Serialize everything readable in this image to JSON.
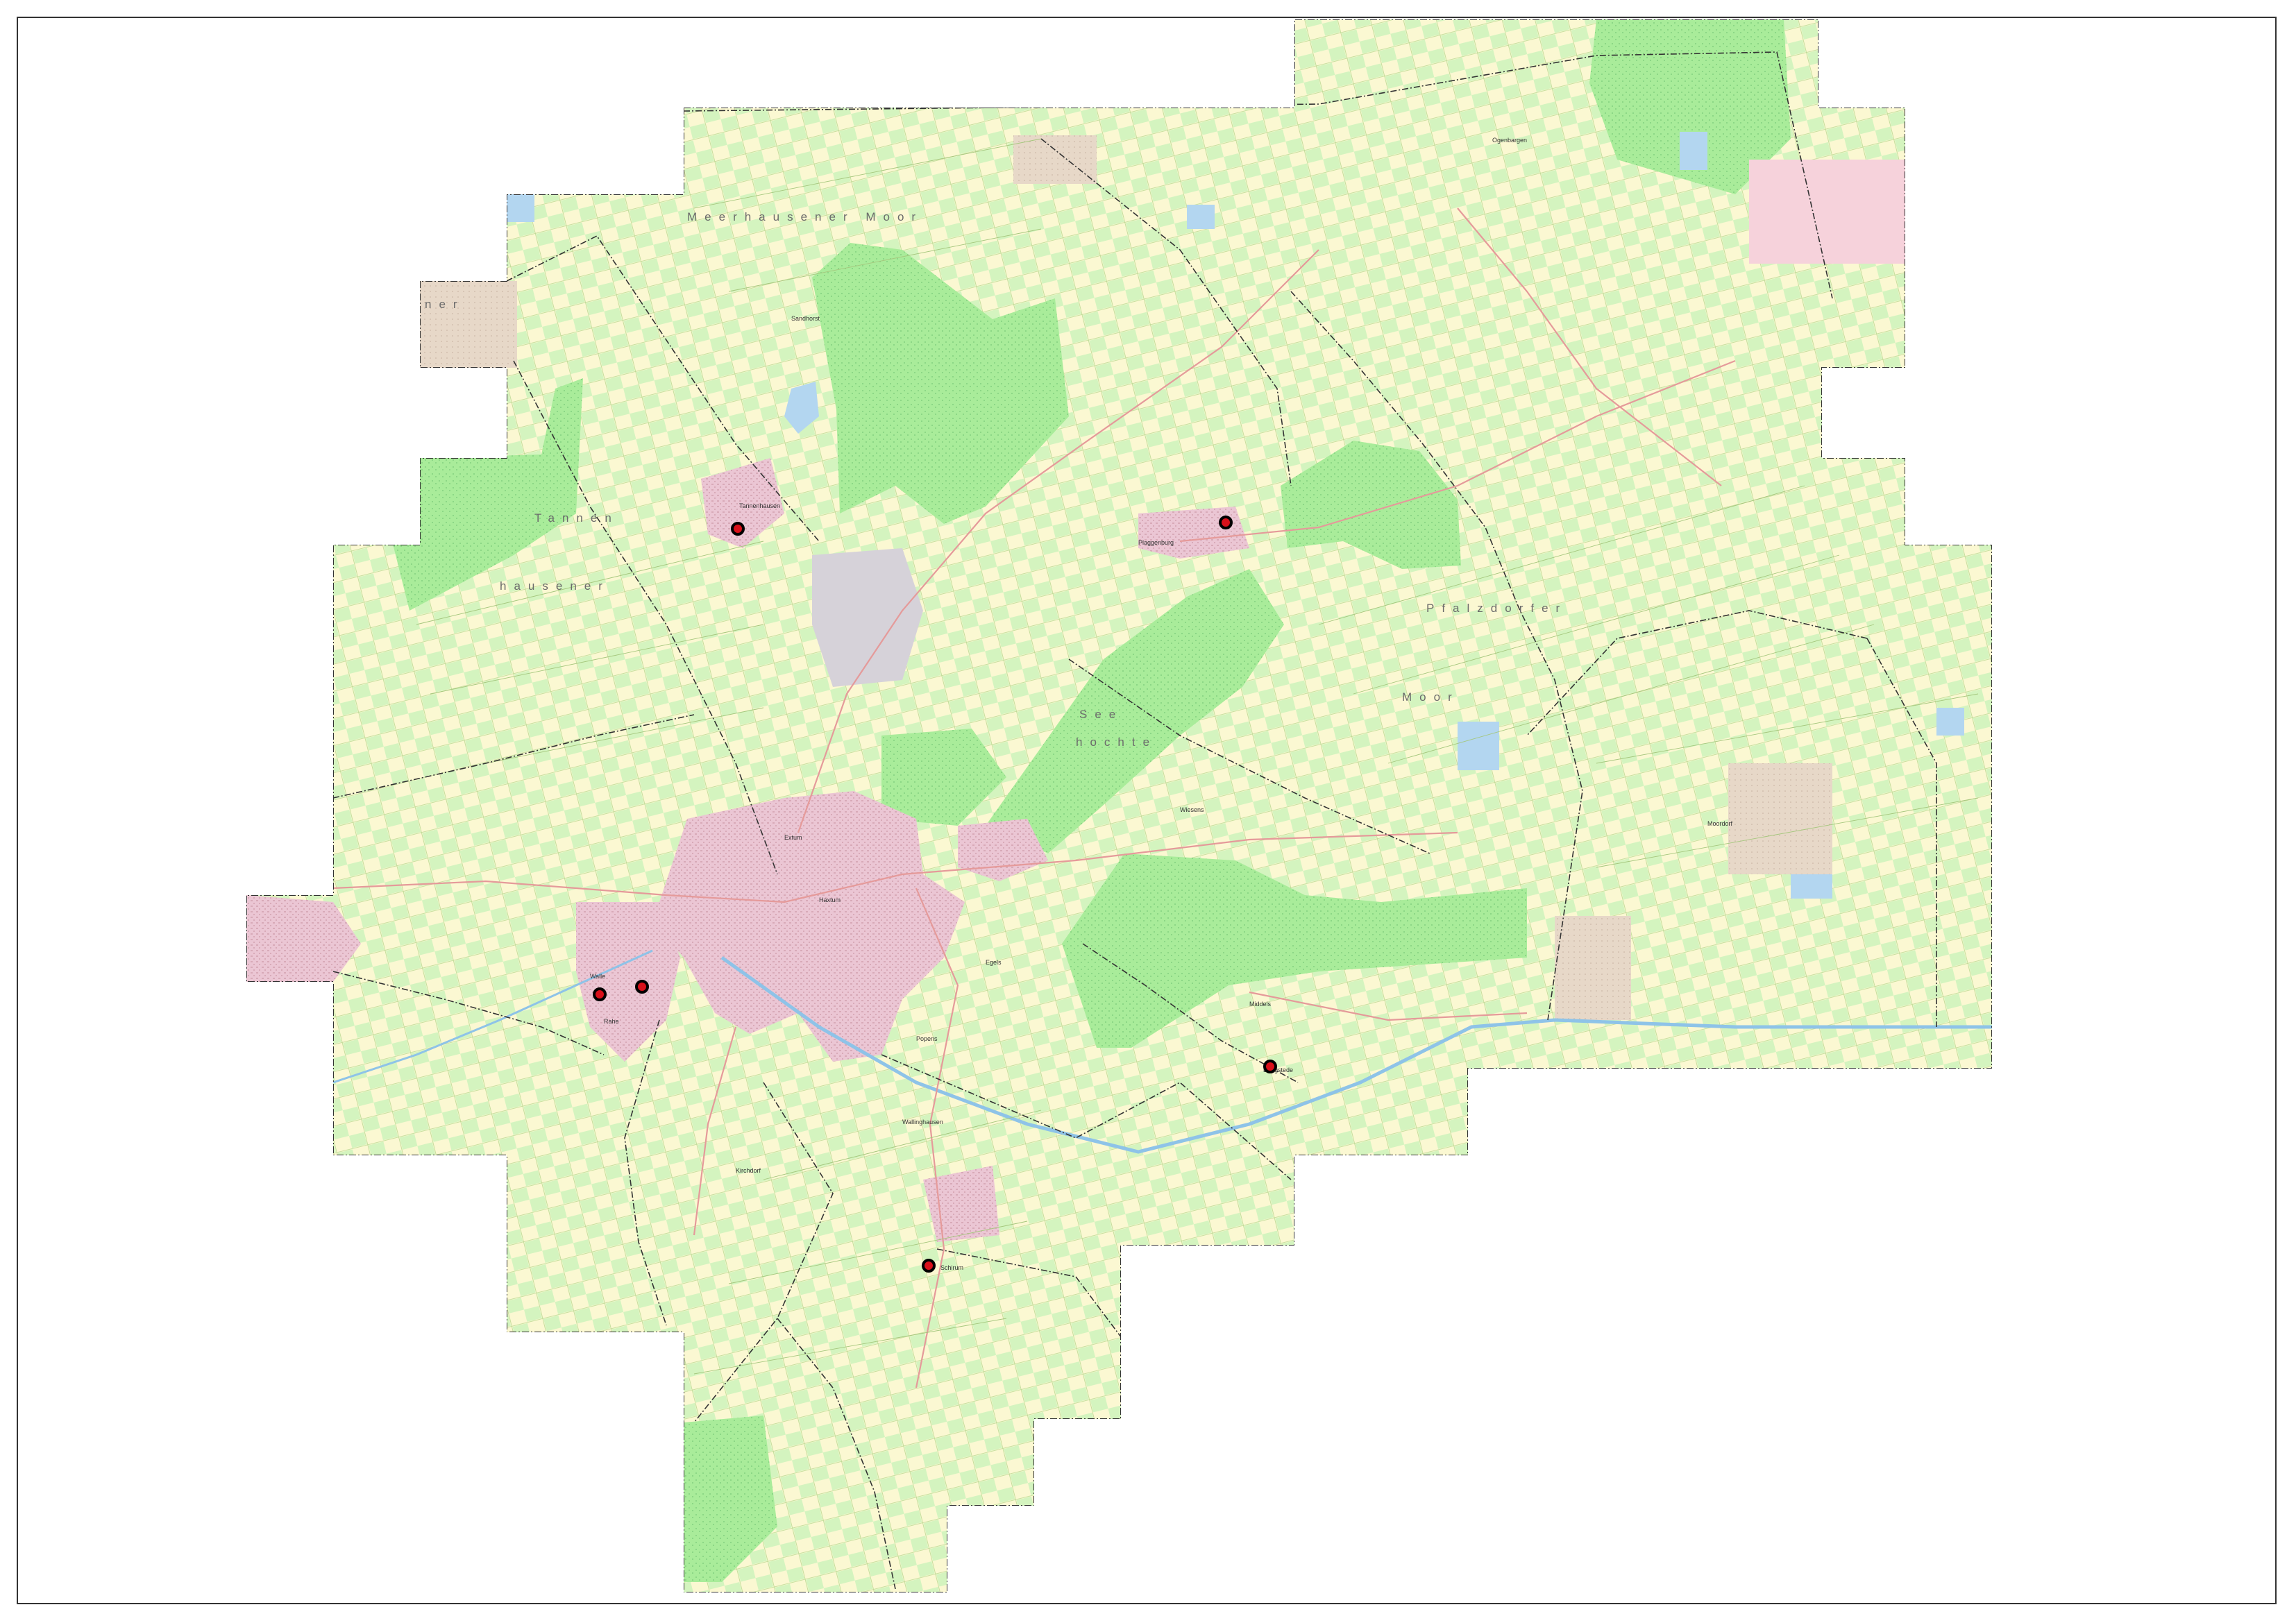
{
  "map": {
    "colors": {
      "land": "#fbf8d2",
      "pasture": "#cdf3b7",
      "forest": "#a9ec9a",
      "urban": "#ecc6d4",
      "water": "#b3d6f0",
      "boundary": "#333333",
      "marker_fill": "#d8101a"
    },
    "region_labels": [
      {
        "id": "meerhausener-moor",
        "text": "Meerhausener Moor"
      },
      {
        "id": "tannen",
        "text": "Tannen"
      },
      {
        "id": "hausener",
        "text": "hausener"
      },
      {
        "id": "pfalzdorfer",
        "text": "Pfalzdorfer"
      },
      {
        "id": "moor",
        "text": "Moor"
      },
      {
        "id": "see",
        "text": "See"
      },
      {
        "id": "hochte",
        "text": "hochte"
      },
      {
        "id": "ner",
        "text": "ner"
      }
    ],
    "place_labels": [
      {
        "id": "plaggenburg",
        "text": "Plaggenburg"
      },
      {
        "id": "ogenbargen",
        "text": "Ogenbargen"
      },
      {
        "id": "sandhorst",
        "text": "Sandhorst"
      },
      {
        "id": "egels",
        "text": "Egels"
      },
      {
        "id": "popens",
        "text": "Popens"
      },
      {
        "id": "extum",
        "text": "Extum"
      },
      {
        "id": "schirum",
        "text": "Schirum"
      },
      {
        "id": "walle",
        "text": "Walle"
      },
      {
        "id": "rahe",
        "text": "Rahe"
      },
      {
        "id": "haxtum",
        "text": "Haxtum"
      },
      {
        "id": "kirchdorf",
        "text": "Kirchdorf"
      },
      {
        "id": "middels",
        "text": "Middels"
      },
      {
        "id": "tannenhausen",
        "text": "Tannenhausen"
      },
      {
        "id": "wiesens",
        "text": "Wiesens"
      },
      {
        "id": "bangstede",
        "text": "Bangstede"
      },
      {
        "id": "wallinghausen",
        "text": "Wallinghausen"
      },
      {
        "id": "sandhorst-2",
        "text": "Moordorf"
      }
    ],
    "markers": [
      {
        "id": "marker-tannenhausen"
      },
      {
        "id": "marker-plaggenburg"
      },
      {
        "id": "marker-west-1"
      },
      {
        "id": "marker-west-2"
      },
      {
        "id": "marker-southeast"
      },
      {
        "id": "marker-south"
      }
    ]
  }
}
